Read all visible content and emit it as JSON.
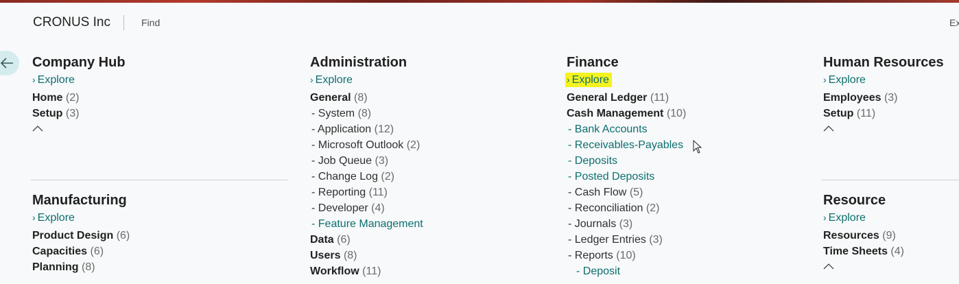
{
  "header": {
    "company": "CRONUS Inc",
    "find": "Find",
    "exit_partial": "Ex"
  },
  "explore_label": "Explore",
  "groups": {
    "company_hub": {
      "title": "Company Hub",
      "items": [
        {
          "label": "Home",
          "count": "(2)"
        },
        {
          "label": "Setup",
          "count": "(3)"
        }
      ]
    },
    "manufacturing": {
      "title": "Manufacturing",
      "items": [
        {
          "label": "Product Design",
          "count": "(6)"
        },
        {
          "label": "Capacities",
          "count": "(6)"
        },
        {
          "label": "Planning",
          "count": "(8)"
        }
      ]
    },
    "administration": {
      "title": "Administration",
      "general": {
        "label": "General",
        "count": "(8)"
      },
      "general_children": [
        {
          "label": "- System",
          "count": "(8)"
        },
        {
          "label": "- Application",
          "count": "(12)"
        },
        {
          "label": "- Microsoft Outlook",
          "count": "(2)"
        },
        {
          "label": "- Job Queue",
          "count": "(3)"
        },
        {
          "label": "- Change Log",
          "count": "(2)"
        },
        {
          "label": "- Reporting",
          "count": "(11)"
        },
        {
          "label": "- Developer",
          "count": "(4)"
        }
      ],
      "feature_management": "- Feature Management",
      "items": [
        {
          "label": "Data",
          "count": "(6)"
        },
        {
          "label": "Users",
          "count": "(8)"
        },
        {
          "label": "Workflow",
          "count": "(11)"
        }
      ]
    },
    "finance": {
      "title": "Finance",
      "general_ledger": {
        "label": "General Ledger",
        "count": "(11)"
      },
      "cash_management": {
        "label": "Cash Management",
        "count": "(10)"
      },
      "cash_links": [
        "- Bank Accounts",
        "- Receivables-Payables",
        "- Deposits",
        "- Posted Deposits"
      ],
      "cash_children": [
        {
          "label": "- Cash Flow",
          "count": "(5)"
        },
        {
          "label": "- Reconciliation",
          "count": "(2)"
        },
        {
          "label": "- Journals",
          "count": "(3)"
        },
        {
          "label": "- Ledger Entries",
          "count": "(3)"
        },
        {
          "label": "- Reports",
          "count": "(10)"
        }
      ],
      "deposit_link": "- Deposit"
    },
    "human_resources": {
      "title": "Human Resources",
      "items": [
        {
          "label": "Employees",
          "count": "(3)"
        },
        {
          "label": "Setup",
          "count": "(11)"
        }
      ]
    },
    "resource": {
      "title": "Resource",
      "items": [
        {
          "label": "Resources",
          "count": "(9)"
        },
        {
          "label": "Time Sheets",
          "count": "(4)"
        }
      ]
    }
  },
  "colors": {
    "link": "#0d6e6e",
    "highlight": "#f5f31f",
    "back_button_bg": "#d5ecee"
  },
  "icons": {
    "back": "arrow-left-icon",
    "chevron_right": "chevron-right-icon",
    "chevron_up": "chevron-up-icon",
    "cursor": "mouse-pointer-icon"
  }
}
